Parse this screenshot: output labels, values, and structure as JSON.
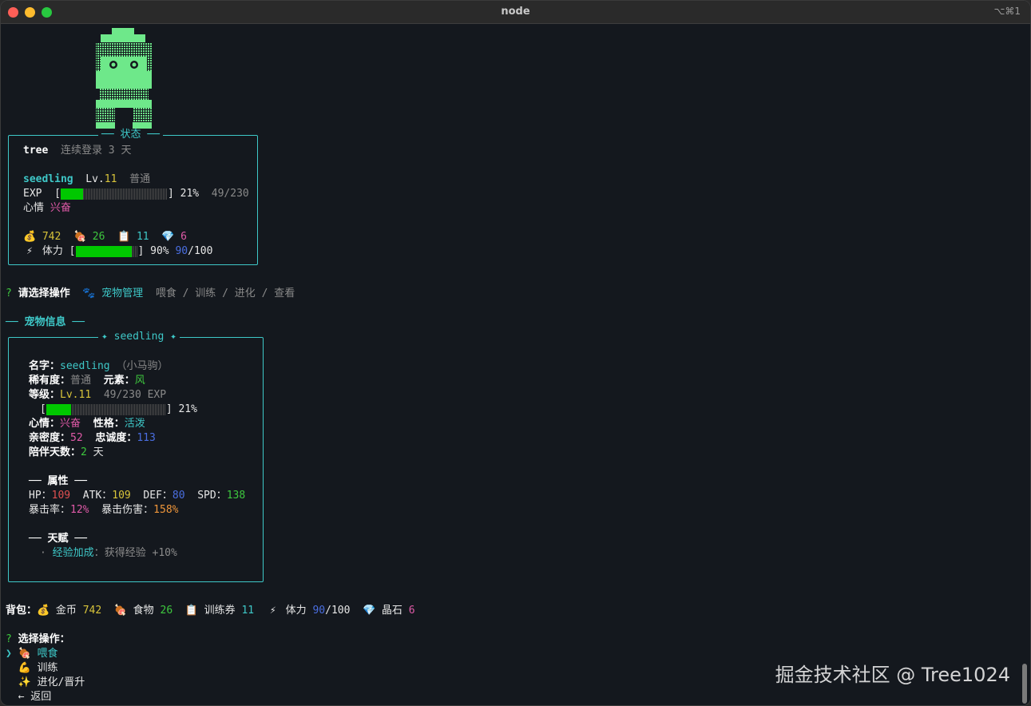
{
  "window": {
    "title": "node",
    "shortcut": "⌥⌘1"
  },
  "status": {
    "box_title": "状态",
    "username": "tree",
    "login_streak": "连续登录 3 天",
    "pet_name": "seedling",
    "level_label": "Lv.",
    "level_value": "11",
    "rarity": "普通",
    "exp_label": "EXP",
    "exp_percent": "21%",
    "exp_fraction": "49/230",
    "exp_progress": 0.21,
    "mood_label": "心情",
    "mood_value": "兴奋",
    "gold": "742",
    "food": "26",
    "tickets": "11",
    "gems": "6",
    "stamina_label": "体力",
    "stamina_percent": "90%",
    "stamina_current": "90",
    "stamina_max": "/100",
    "stamina_progress": 0.9
  },
  "prompt1": {
    "mark": "?",
    "question": "请选择操作",
    "answer": "宠物管理",
    "hint": "喂食 / 训练 / 进化 / 查看"
  },
  "pet_info": {
    "section_title": "宠物信息",
    "box_title": "✦ seedling ✦",
    "name_label": "名字：",
    "name_value": "seedling",
    "name_alias": "（小马驹）",
    "rarity_label": "稀有度：",
    "rarity_value": "普通",
    "element_label": "元素：",
    "element_value": "风",
    "level_label": "等级：",
    "level_value": "Lv.11",
    "exp_text": "49/230 EXP",
    "exp_percent": "21%",
    "exp_progress": 0.21,
    "mood_label": "心情：",
    "mood_value": "兴奋",
    "personality_label": "性格：",
    "personality_value": "活泼",
    "intimacy_label": "亲密度：",
    "intimacy_value": "52",
    "loyalty_label": "忠诚度：",
    "loyalty_value": "113",
    "days_label": "陪伴天数：",
    "days_value": "2",
    "days_unit": "天",
    "attr_title": "属性",
    "hp_label": "HP：",
    "hp_value": "109",
    "atk_label": "ATK：",
    "atk_value": "109",
    "def_label": "DEF：",
    "def_value": "80",
    "spd_label": "SPD：",
    "spd_value": "138",
    "crit_label": "暴击率：",
    "crit_value": "12%",
    "critdmg_label": "暴击伤害：",
    "critdmg_value": "158%",
    "talent_title": "天赋",
    "talent_name": "经验加成",
    "talent_desc": "获得经验 +10%"
  },
  "bag": {
    "label": "背包：",
    "gold_label": "金币",
    "gold_value": "742",
    "food_label": "食物",
    "food_value": "26",
    "tickets_label": "训练券",
    "tickets_value": "11",
    "stamina_label": "体力",
    "stamina_current": "90",
    "stamina_max": "/100",
    "gems_label": "晶石",
    "gems_value": "6"
  },
  "menu": {
    "mark": "?",
    "question": "选择操作：",
    "cursor": "❯",
    "items": [
      {
        "icon": "meat-icon",
        "label": "喂食"
      },
      {
        "icon": "muscle-icon",
        "label": "训练"
      },
      {
        "icon": "sparkles-icon",
        "label": "进化/晋升"
      },
      {
        "icon": "left-arrow-icon",
        "label": "← 返回"
      }
    ]
  },
  "watermark": "掘金技术社区 @ Tree1024",
  "icons": {
    "gold": "moneybag-icon",
    "food": "meat-icon",
    "tickets": "clipboard-icon",
    "gems": "gem-icon",
    "stamina": "lightning-icon",
    "paw": "paw-icon"
  },
  "colors": {
    "accent": "#3ec8c8",
    "exp_bar": "#00c800",
    "pet": "#6ee88a",
    "background": "#14181e"
  }
}
